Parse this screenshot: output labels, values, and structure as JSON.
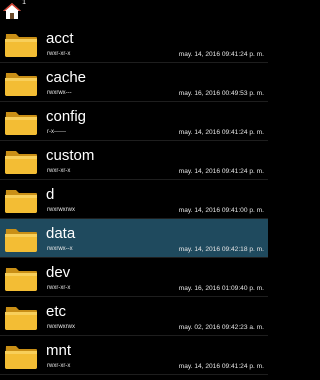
{
  "toolbar": {
    "home_icon": "home-icon",
    "home_badge": "1"
  },
  "colors": {
    "background": "#000000",
    "selected_row": "#1f4a5e",
    "folder": "#f0b82f",
    "text": "#ffffff"
  },
  "files": [
    {
      "name": "acct",
      "perm": "rwxr-xr-x",
      "date": "may. 14, 2016 09:41:24 p. m.",
      "selected": false
    },
    {
      "name": "cache",
      "perm": "rwxrwx---",
      "date": "may. 16, 2016 00:49:53 p. m.",
      "selected": false
    },
    {
      "name": "config",
      "perm": "r-x------",
      "date": "may. 14, 2016 09:41:24 p. m.",
      "selected": false
    },
    {
      "name": "custom",
      "perm": "rwxr-xr-x",
      "date": "may. 14, 2016 09:41:24 p. m.",
      "selected": false
    },
    {
      "name": "d",
      "perm": "rwxrwxrwx",
      "date": "may. 14, 2016 09:41:00 p. m.",
      "selected": false
    },
    {
      "name": "data",
      "perm": "rwxrwx--x",
      "date": "may. 14, 2016 09:42:18 p. m.",
      "selected": true
    },
    {
      "name": "dev",
      "perm": "rwxr-xr-x",
      "date": "may. 16, 2016 01:09:40 p. m.",
      "selected": false
    },
    {
      "name": "etc",
      "perm": "rwxrwxrwx",
      "date": "may. 02, 2016 09:42:23 a. m.",
      "selected": false
    },
    {
      "name": "mnt",
      "perm": "rwxr-xr-x",
      "date": "may. 14, 2016 09:41:24 p. m.",
      "selected": false
    }
  ]
}
